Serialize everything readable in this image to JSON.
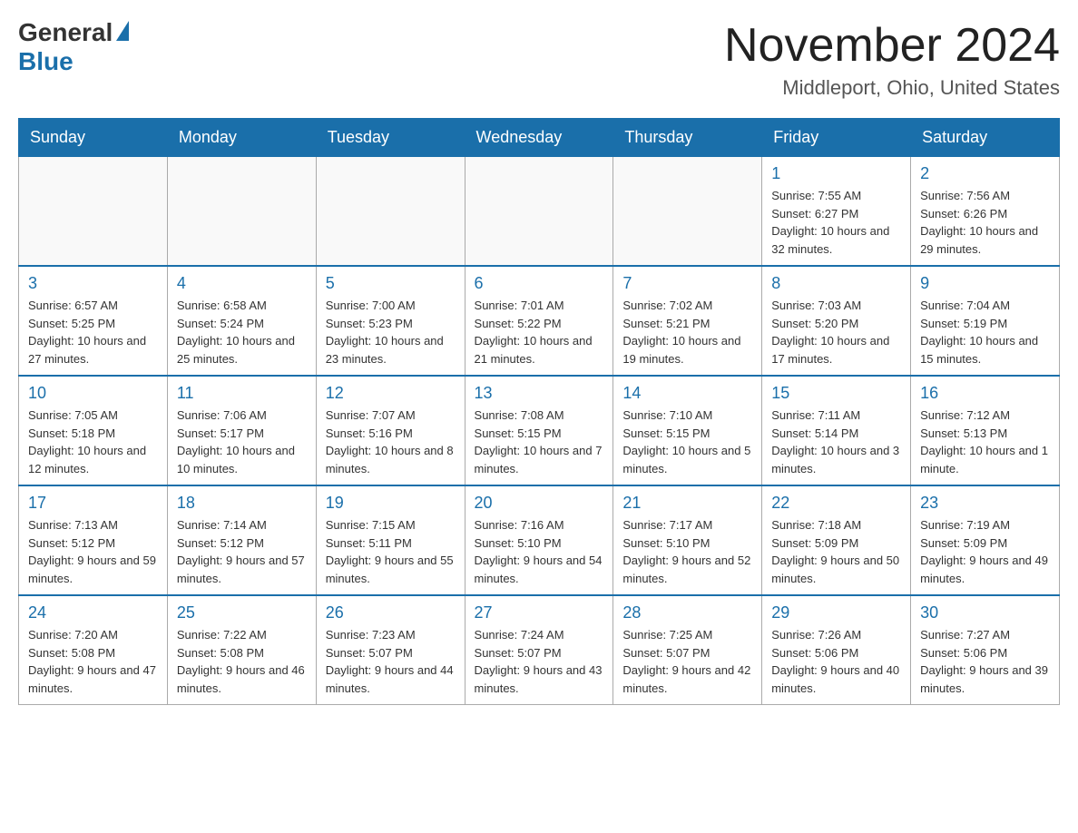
{
  "header": {
    "logo_general": "General",
    "logo_blue": "Blue",
    "month_title": "November 2024",
    "location": "Middleport, Ohio, United States"
  },
  "days_of_week": [
    "Sunday",
    "Monday",
    "Tuesday",
    "Wednesday",
    "Thursday",
    "Friday",
    "Saturday"
  ],
  "weeks": [
    [
      {
        "day": "",
        "info": ""
      },
      {
        "day": "",
        "info": ""
      },
      {
        "day": "",
        "info": ""
      },
      {
        "day": "",
        "info": ""
      },
      {
        "day": "",
        "info": ""
      },
      {
        "day": "1",
        "info": "Sunrise: 7:55 AM\nSunset: 6:27 PM\nDaylight: 10 hours and 32 minutes."
      },
      {
        "day": "2",
        "info": "Sunrise: 7:56 AM\nSunset: 6:26 PM\nDaylight: 10 hours and 29 minutes."
      }
    ],
    [
      {
        "day": "3",
        "info": "Sunrise: 6:57 AM\nSunset: 5:25 PM\nDaylight: 10 hours and 27 minutes."
      },
      {
        "day": "4",
        "info": "Sunrise: 6:58 AM\nSunset: 5:24 PM\nDaylight: 10 hours and 25 minutes."
      },
      {
        "day": "5",
        "info": "Sunrise: 7:00 AM\nSunset: 5:23 PM\nDaylight: 10 hours and 23 minutes."
      },
      {
        "day": "6",
        "info": "Sunrise: 7:01 AM\nSunset: 5:22 PM\nDaylight: 10 hours and 21 minutes."
      },
      {
        "day": "7",
        "info": "Sunrise: 7:02 AM\nSunset: 5:21 PM\nDaylight: 10 hours and 19 minutes."
      },
      {
        "day": "8",
        "info": "Sunrise: 7:03 AM\nSunset: 5:20 PM\nDaylight: 10 hours and 17 minutes."
      },
      {
        "day": "9",
        "info": "Sunrise: 7:04 AM\nSunset: 5:19 PM\nDaylight: 10 hours and 15 minutes."
      }
    ],
    [
      {
        "day": "10",
        "info": "Sunrise: 7:05 AM\nSunset: 5:18 PM\nDaylight: 10 hours and 12 minutes."
      },
      {
        "day": "11",
        "info": "Sunrise: 7:06 AM\nSunset: 5:17 PM\nDaylight: 10 hours and 10 minutes."
      },
      {
        "day": "12",
        "info": "Sunrise: 7:07 AM\nSunset: 5:16 PM\nDaylight: 10 hours and 8 minutes."
      },
      {
        "day": "13",
        "info": "Sunrise: 7:08 AM\nSunset: 5:15 PM\nDaylight: 10 hours and 7 minutes."
      },
      {
        "day": "14",
        "info": "Sunrise: 7:10 AM\nSunset: 5:15 PM\nDaylight: 10 hours and 5 minutes."
      },
      {
        "day": "15",
        "info": "Sunrise: 7:11 AM\nSunset: 5:14 PM\nDaylight: 10 hours and 3 minutes."
      },
      {
        "day": "16",
        "info": "Sunrise: 7:12 AM\nSunset: 5:13 PM\nDaylight: 10 hours and 1 minute."
      }
    ],
    [
      {
        "day": "17",
        "info": "Sunrise: 7:13 AM\nSunset: 5:12 PM\nDaylight: 9 hours and 59 minutes."
      },
      {
        "day": "18",
        "info": "Sunrise: 7:14 AM\nSunset: 5:12 PM\nDaylight: 9 hours and 57 minutes."
      },
      {
        "day": "19",
        "info": "Sunrise: 7:15 AM\nSunset: 5:11 PM\nDaylight: 9 hours and 55 minutes."
      },
      {
        "day": "20",
        "info": "Sunrise: 7:16 AM\nSunset: 5:10 PM\nDaylight: 9 hours and 54 minutes."
      },
      {
        "day": "21",
        "info": "Sunrise: 7:17 AM\nSunset: 5:10 PM\nDaylight: 9 hours and 52 minutes."
      },
      {
        "day": "22",
        "info": "Sunrise: 7:18 AM\nSunset: 5:09 PM\nDaylight: 9 hours and 50 minutes."
      },
      {
        "day": "23",
        "info": "Sunrise: 7:19 AM\nSunset: 5:09 PM\nDaylight: 9 hours and 49 minutes."
      }
    ],
    [
      {
        "day": "24",
        "info": "Sunrise: 7:20 AM\nSunset: 5:08 PM\nDaylight: 9 hours and 47 minutes."
      },
      {
        "day": "25",
        "info": "Sunrise: 7:22 AM\nSunset: 5:08 PM\nDaylight: 9 hours and 46 minutes."
      },
      {
        "day": "26",
        "info": "Sunrise: 7:23 AM\nSunset: 5:07 PM\nDaylight: 9 hours and 44 minutes."
      },
      {
        "day": "27",
        "info": "Sunrise: 7:24 AM\nSunset: 5:07 PM\nDaylight: 9 hours and 43 minutes."
      },
      {
        "day": "28",
        "info": "Sunrise: 7:25 AM\nSunset: 5:07 PM\nDaylight: 9 hours and 42 minutes."
      },
      {
        "day": "29",
        "info": "Sunrise: 7:26 AM\nSunset: 5:06 PM\nDaylight: 9 hours and 40 minutes."
      },
      {
        "day": "30",
        "info": "Sunrise: 7:27 AM\nSunset: 5:06 PM\nDaylight: 9 hours and 39 minutes."
      }
    ]
  ]
}
